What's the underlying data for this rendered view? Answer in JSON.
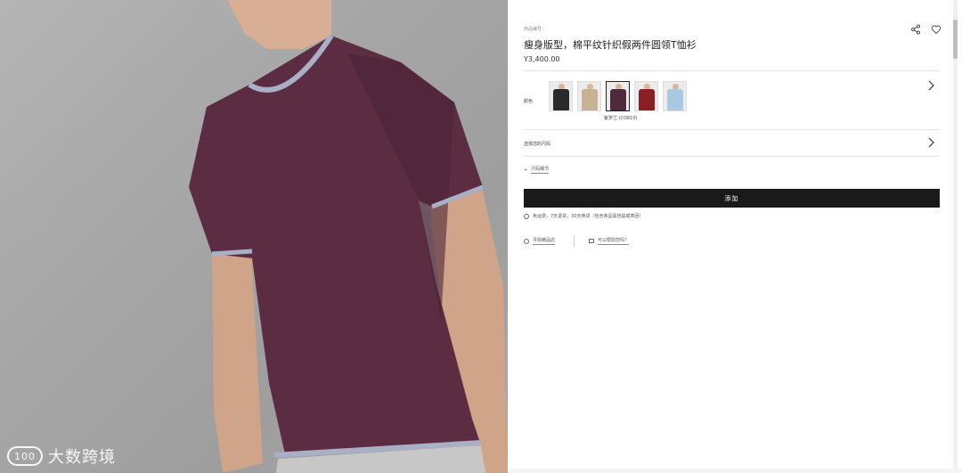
{
  "product": {
    "sku": "商品编号：  ",
    "title": "瘦身版型，棉平纹针织假两件圆领T恤衫",
    "price": "Y3,400.00"
  },
  "color": {
    "label": "颜色",
    "selected_caption": "紫罗兰 (CO810)",
    "swatches": [
      {
        "name": "black",
        "hex": "#2a2a2a"
      },
      {
        "name": "beige",
        "hex": "#c9b193"
      },
      {
        "name": "plum",
        "hex": "#4f2a3c"
      },
      {
        "name": "red",
        "hex": "#8a1f24"
      },
      {
        "name": "light-blue",
        "hex": "#a9c8e2"
      }
    ]
  },
  "size": {
    "label": "选择您的尺码"
  },
  "details": {
    "label": "尺码细节"
  },
  "cart": {
    "add_label": "添加"
  },
  "shipping": {
    "note": "免运费，7天退货，30天换货（包含商品需自提或寄回）"
  },
  "links": {
    "store": "寻找精品店",
    "help": "可以帮助您吗？"
  },
  "watermark": {
    "text": "大数跨境"
  },
  "colors": {
    "accent": "#1a1a1a",
    "shirt": "#5b2c42",
    "trim": "#a9b0c6"
  }
}
